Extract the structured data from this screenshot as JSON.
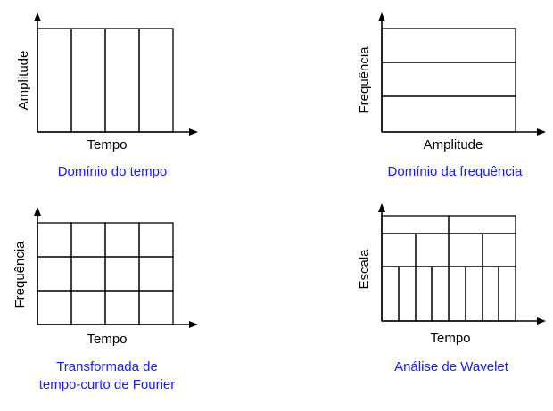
{
  "colors": {
    "caption": "#1a1aff",
    "lines": "#000000",
    "background": "#ffffff"
  },
  "panels": [
    {
      "id": "time-domain",
      "ylabel": "Amplitude",
      "xlabel": "Tempo",
      "caption_lines": [
        "Domínio do tempo"
      ]
    },
    {
      "id": "frequency-domain",
      "ylabel": "Frequência",
      "xlabel": "Amplitude",
      "caption_lines": [
        "Domínio da frequência"
      ]
    },
    {
      "id": "stft",
      "ylabel": "Frequência",
      "xlabel": "Tempo",
      "caption_lines": [
        "Transformada de",
        "tempo-curto de Fourier"
      ]
    },
    {
      "id": "wavelet",
      "ylabel": "Escala",
      "xlabel": "Tempo",
      "caption_lines": [
        "Análise de Wavelet"
      ]
    }
  ]
}
